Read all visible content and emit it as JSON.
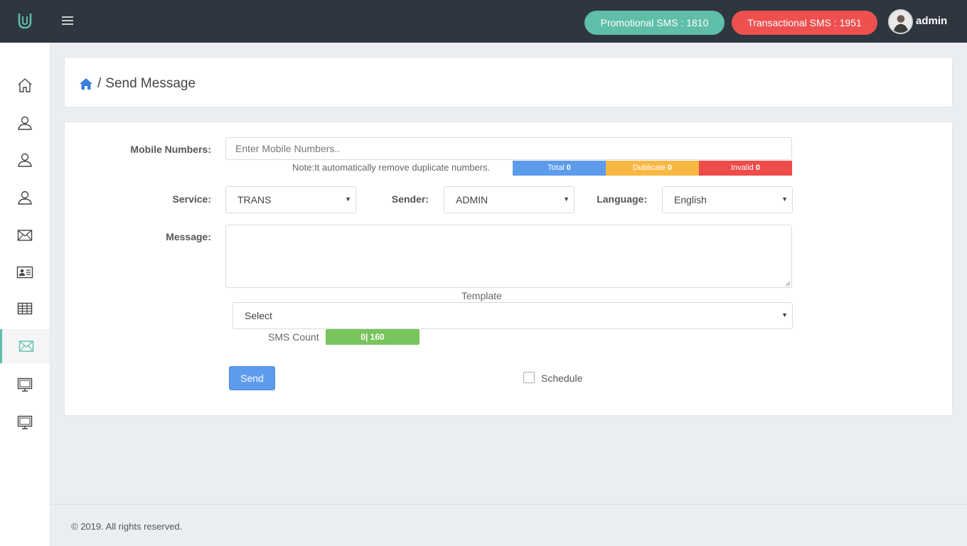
{
  "header": {
    "promo_label": "Promotional SMS : 1810",
    "trans_label": "Transactional SMS : 1951",
    "user_name": "admin",
    "colors": {
      "topbar": "#2e363f",
      "promo": "#5fbea9",
      "trans": "#ee5050"
    }
  },
  "sidebar": {
    "items": [
      {
        "icon": "home-icon"
      },
      {
        "icon": "user-icon"
      },
      {
        "icon": "user-icon"
      },
      {
        "icon": "user-icon"
      },
      {
        "icon": "mail-icon"
      },
      {
        "icon": "contact-card-icon"
      },
      {
        "icon": "table-icon"
      },
      {
        "icon": "mail-icon",
        "active": true
      },
      {
        "icon": "monitor-icon"
      },
      {
        "icon": "monitor-icon"
      }
    ]
  },
  "breadcrumb": {
    "separator": "/",
    "title": "Send Message"
  },
  "form": {
    "mobile_label": "Mobile Numbers:",
    "mobile_placeholder": "Enter Mobile Numbers..",
    "note": "Note:It automatically remove duplicate numbers.",
    "stats": {
      "total_label": "Total",
      "total_value": "0",
      "duplicate_label": "Dublicate",
      "duplicate_value": "0",
      "invalid_label": "Invalid",
      "invalid_value": "0"
    },
    "service_label": "Service:",
    "service_value": "TRANS",
    "sender_label": "Sender:",
    "sender_value": "ADMIN",
    "language_label": "Language:",
    "language_value": "English",
    "message_label": "Message:",
    "message_value": "",
    "template_label": "Template",
    "template_value": "Select",
    "sms_count_label": "SMS Count",
    "sms_count_value": "0| 160",
    "send_label": "Send",
    "schedule_label": "Schedule",
    "schedule_checked": false
  },
  "footer": {
    "copyright": "© 2019. All rights reserved."
  }
}
